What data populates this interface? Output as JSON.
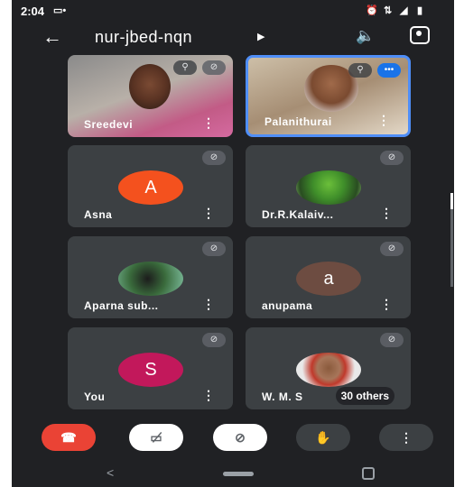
{
  "status_bar": {
    "time": "2:04"
  },
  "header": {
    "title": "nur-jbed-nqn"
  },
  "tiles": [
    {
      "name": "Sreedevi",
      "menu": "⋮"
    },
    {
      "name": "Palanithurai",
      "menu": "⋮"
    },
    {
      "name": "Asna",
      "avatar_letter": "A",
      "avatar_color": "#f4511e",
      "menu": "⋮"
    },
    {
      "name": "Dr.R.Kalaiv...",
      "menu": "⋮"
    },
    {
      "name": "Aparna sub...",
      "menu": "⋮"
    },
    {
      "name": "anupama",
      "avatar_letter": "a",
      "avatar_color": "#6d4c41",
      "menu": "⋮"
    },
    {
      "name": "You",
      "avatar_letter": "S",
      "avatar_color": "#c2185b",
      "menu": "⋮"
    },
    {
      "name": "W. M. S",
      "others": "30 others"
    }
  ],
  "colors": {
    "end_call": "#ea4335",
    "speaking_border": "#4f8ef7"
  },
  "icons": [
    "back-arrow-icon",
    "caret-right-icon",
    "speaker-icon",
    "switch-camera-icon",
    "mic-off-icon",
    "pin-icon",
    "more-vert-icon",
    "end-call-icon",
    "camera-off-icon",
    "raise-hand-icon"
  ]
}
